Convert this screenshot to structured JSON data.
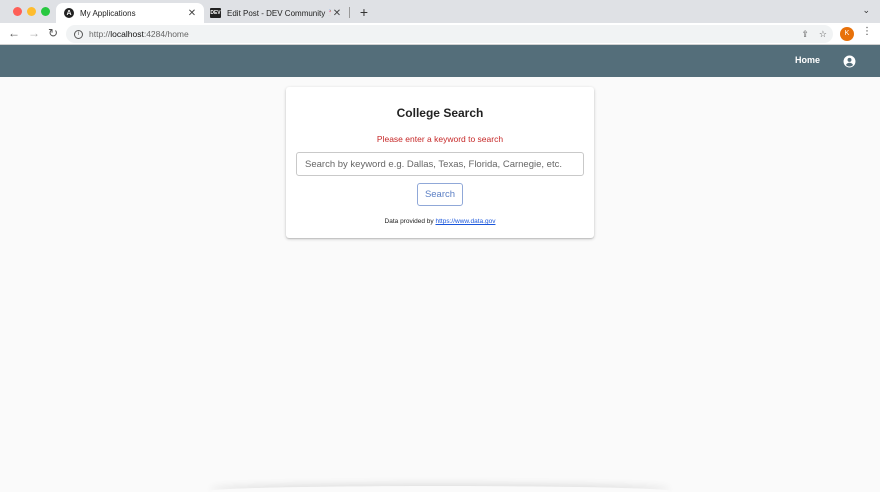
{
  "browser": {
    "tabs": [
      {
        "title": "My Applications",
        "favicon": "A",
        "active": true
      },
      {
        "title": "Edit Post - DEV Community 🦄 :",
        "favicon": "DEV",
        "active": false
      }
    ],
    "new_tab": "+",
    "url": {
      "prefix": "http://",
      "host": "localhost",
      "path": ":4284/home"
    },
    "profile_initial": "K"
  },
  "header": {
    "home_label": "Home",
    "background": "#546e7a"
  },
  "card": {
    "title": "College Search",
    "error_message": "Please enter a keyword to search",
    "search_placeholder": "Search by keyword e.g. Dallas, Texas, Florida, Carnegie, etc.",
    "search_button": "Search",
    "credit_prefix": "Data provided by ",
    "credit_link": "https://www.data.gov"
  },
  "colors": {
    "error": "#c62828",
    "accent": "#5b7fc4",
    "link": "#1a56db"
  }
}
